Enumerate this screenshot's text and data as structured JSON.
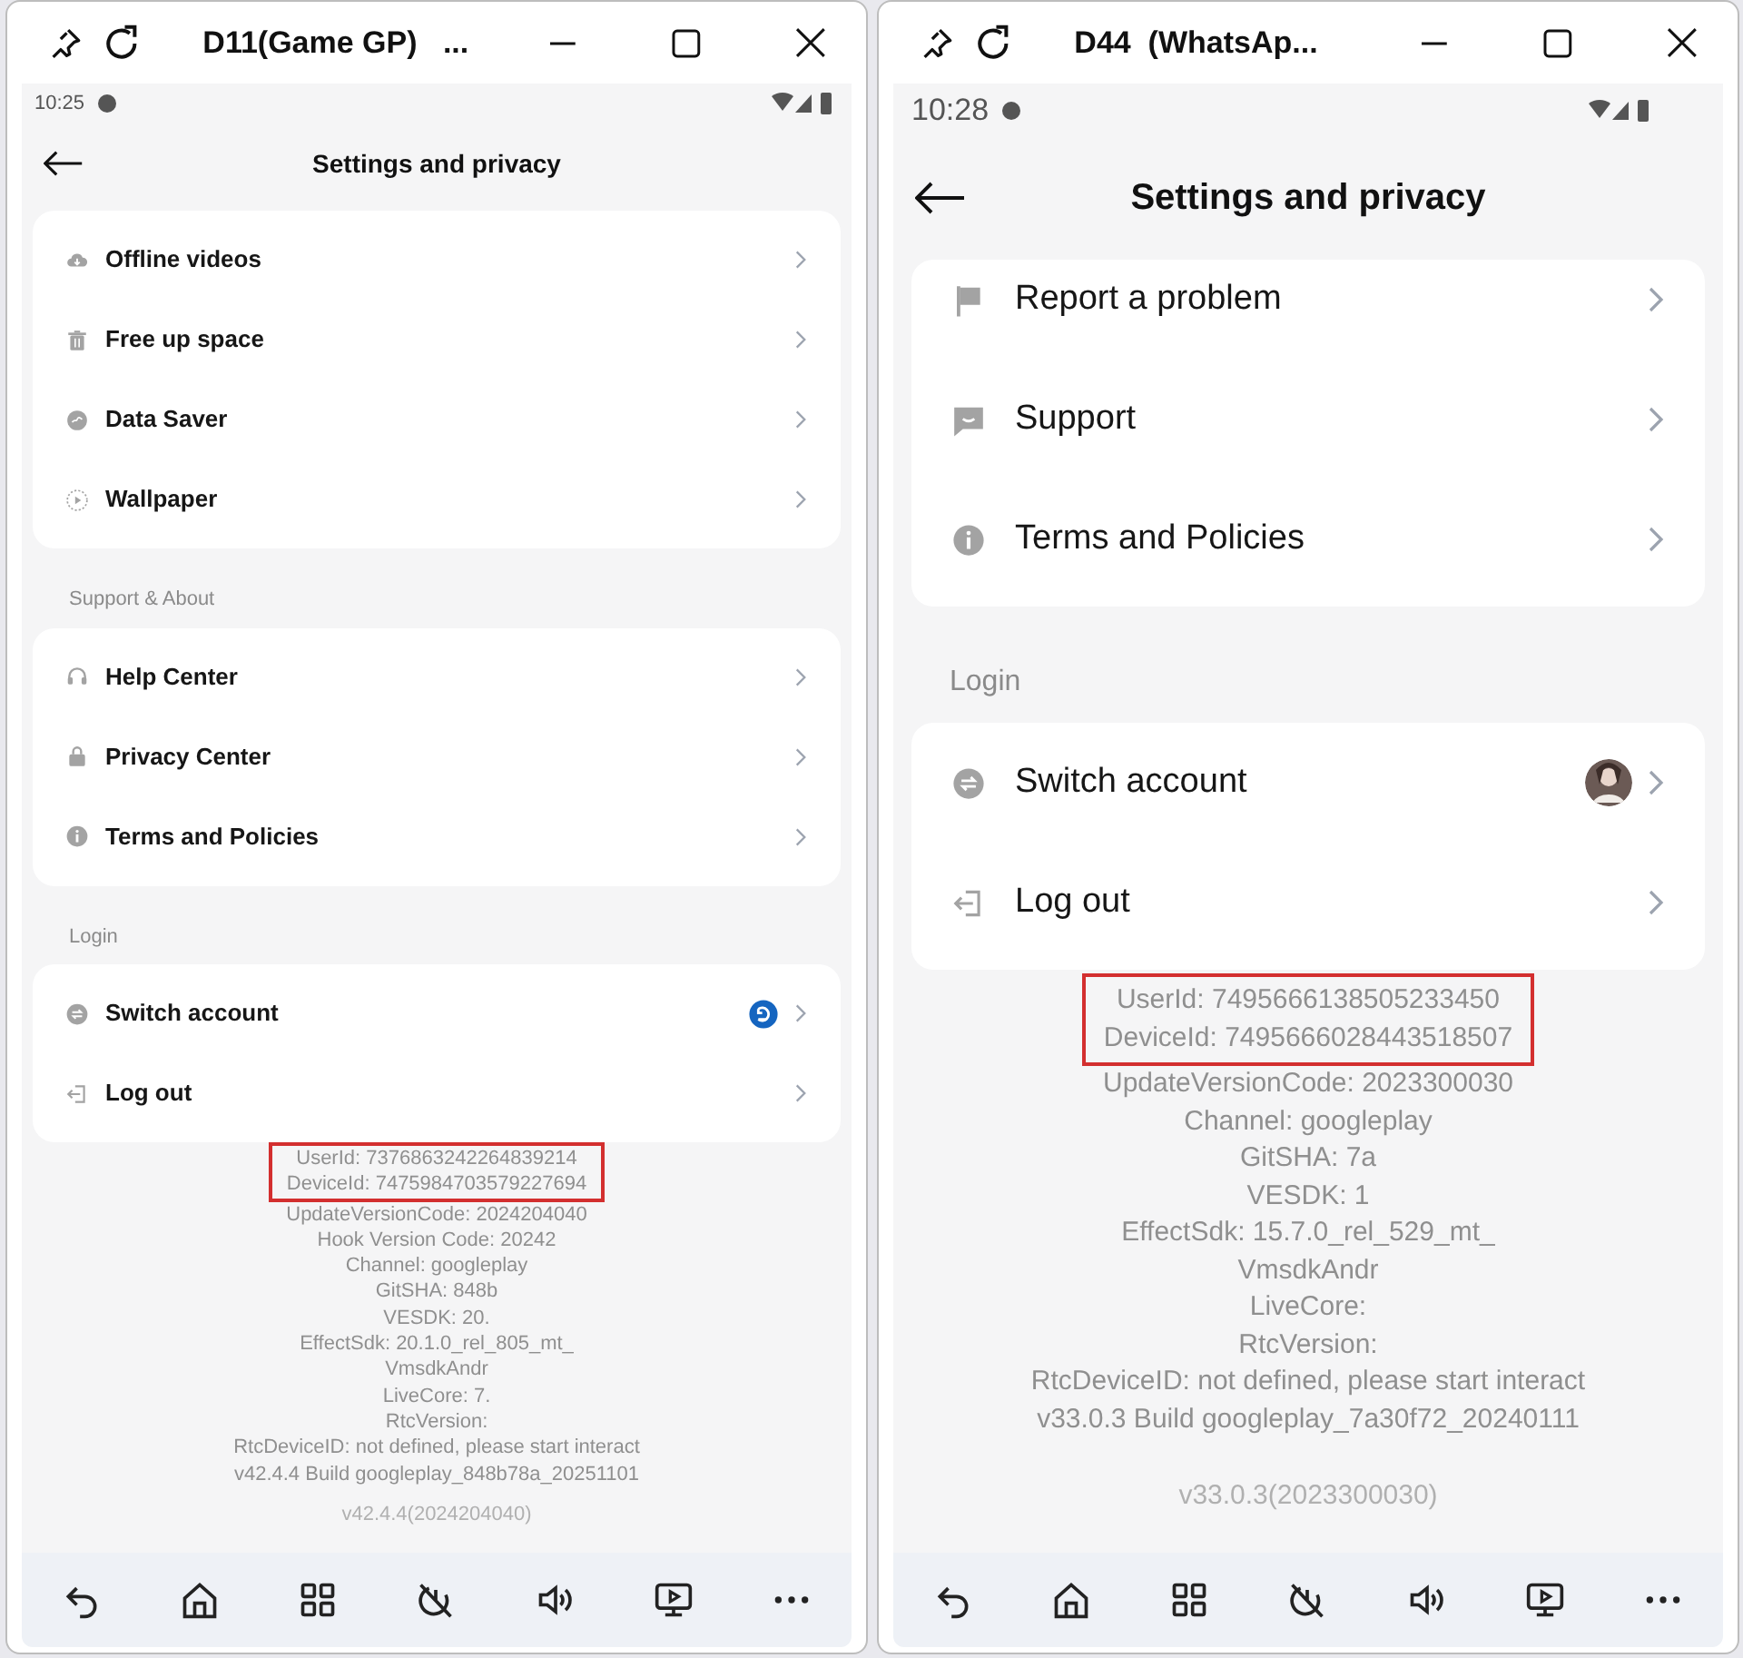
{
  "windows": [
    {
      "title": "D11(Game GP)   ...",
      "status_time": "10:25",
      "header": "Settings and privacy",
      "sections": [
        {
          "items": [
            {
              "label": "Offline videos",
              "kind": "plain"
            },
            {
              "label": "Free up space",
              "kind": "plain"
            },
            {
              "label": "Data Saver",
              "kind": "plain"
            },
            {
              "label": "Wallpaper",
              "kind": "plain"
            }
          ]
        },
        {
          "label": "Support & About",
          "items": [
            {
              "label": "Help Center",
              "kind": "plain"
            },
            {
              "label": "Privacy Center",
              "kind": "plain"
            },
            {
              "label": "Terms and Policies",
              "kind": "plain"
            }
          ]
        },
        {
          "label": "Login",
          "items": [
            {
              "label": "Switch account",
              "kind": "badge"
            },
            {
              "label": "Log out",
              "kind": "plain"
            }
          ]
        }
      ],
      "highlighted_info": [
        "UserId: 7376863242264839214",
        "DeviceId: 7475984703579227694"
      ],
      "info_lines": [
        "UpdateVersionCode: 2024204040",
        "Hook Version Code: 20242",
        "Channel: googleplay",
        "GitSHA: 848b",
        "VESDK: 20.",
        "EffectSdk: 20.1.0_rel_805_mt_",
        "VmsdkAndr",
        "LiveCore: 7.",
        "RtcVersion:",
        "RtcDeviceID: not defined, please start interact",
        "v42.4.4 Build googleplay_848b78a_20251101"
      ],
      "version": "v42.4.4(2024204040)"
    },
    {
      "title": "D44  (WhatsAp...",
      "status_time": "10:28",
      "header": "Settings and privacy",
      "sections": [
        {
          "items": [
            {
              "label": "Report a problem",
              "kind": "plain"
            },
            {
              "label": "Support",
              "kind": "plain"
            },
            {
              "label": "Terms and Policies",
              "kind": "plain"
            }
          ]
        },
        {
          "label": "Login",
          "items": [
            {
              "label": "Switch account",
              "kind": "avatar"
            },
            {
              "label": "Log out",
              "kind": "plain"
            }
          ]
        }
      ],
      "highlighted_info": [
        "UserId: 7495666138505233450",
        "DeviceId: 7495666028443518507"
      ],
      "info_lines": [
        "UpdateVersionCode: 2023300030",
        "Channel: googleplay",
        "GitSHA: 7a",
        "VESDK: 1",
        "EffectSdk: 15.7.0_rel_529_mt_",
        "VmsdkAndr",
        "LiveCore:",
        "RtcVersion:",
        "RtcDeviceID: not defined, please start interact",
        "v33.0.3 Build googleplay_7a30f72_20240111"
      ],
      "version": "v33.0.3(2023300030)"
    }
  ]
}
